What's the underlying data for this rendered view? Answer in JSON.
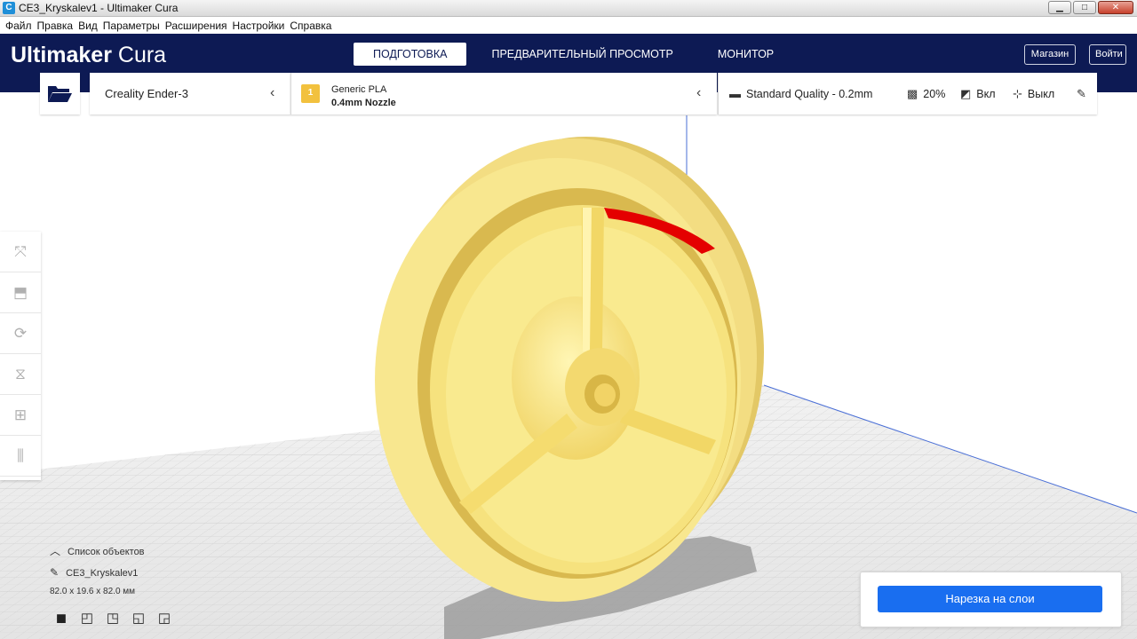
{
  "window": {
    "icon_letter": "C",
    "title": "CE3_Kryskalev1 - Ultimaker Cura",
    "controls": {
      "minimize": "▁",
      "maximize": "□",
      "close": "✕"
    }
  },
  "menu": [
    "Файл",
    "Правка",
    "Вид",
    "Параметры",
    "Расширения",
    "Настройки",
    "Справка"
  ],
  "header": {
    "logo_bold": "Ultimaker",
    "logo_light": " Cura",
    "tabs": [
      "ПОДГОТОВКА",
      "ПРЕДВАРИТЕЛЬНЫЙ ПРОСМОТР",
      "МОНИТОР"
    ],
    "active_tab": "ПОДГОТОВКА",
    "marketplace_label": "Магазин",
    "signin_label": "Войти"
  },
  "toolbar": {
    "printer": "Creality Ender-3",
    "material_badge": "1",
    "material_name": "Generic PLA",
    "nozzle": "0.4mm Nozzle",
    "quality": "Standard Quality - 0.2mm",
    "infill": "20%",
    "support": "Вкл",
    "adhesion": "Выкл",
    "chevron": "‹"
  },
  "tools": [
    "move-tool",
    "scale-tool",
    "rotate-tool",
    "mirror-tool",
    "per-model-settings-tool",
    "support-blocker-tool"
  ],
  "object_list": {
    "header": "Список объектов",
    "object_name": "CE3_Kryskalev1",
    "dimensions": "82.0 x 19.6 x 82.0 мм"
  },
  "slice_button": "Нарезка на слои",
  "colors": {
    "header_bg": "#0d1a54",
    "model_yellow": "#f7e58c",
    "overhang_red": "#e40000",
    "accent_blue": "#196ef0",
    "build_plate": "#e7e7e7"
  }
}
